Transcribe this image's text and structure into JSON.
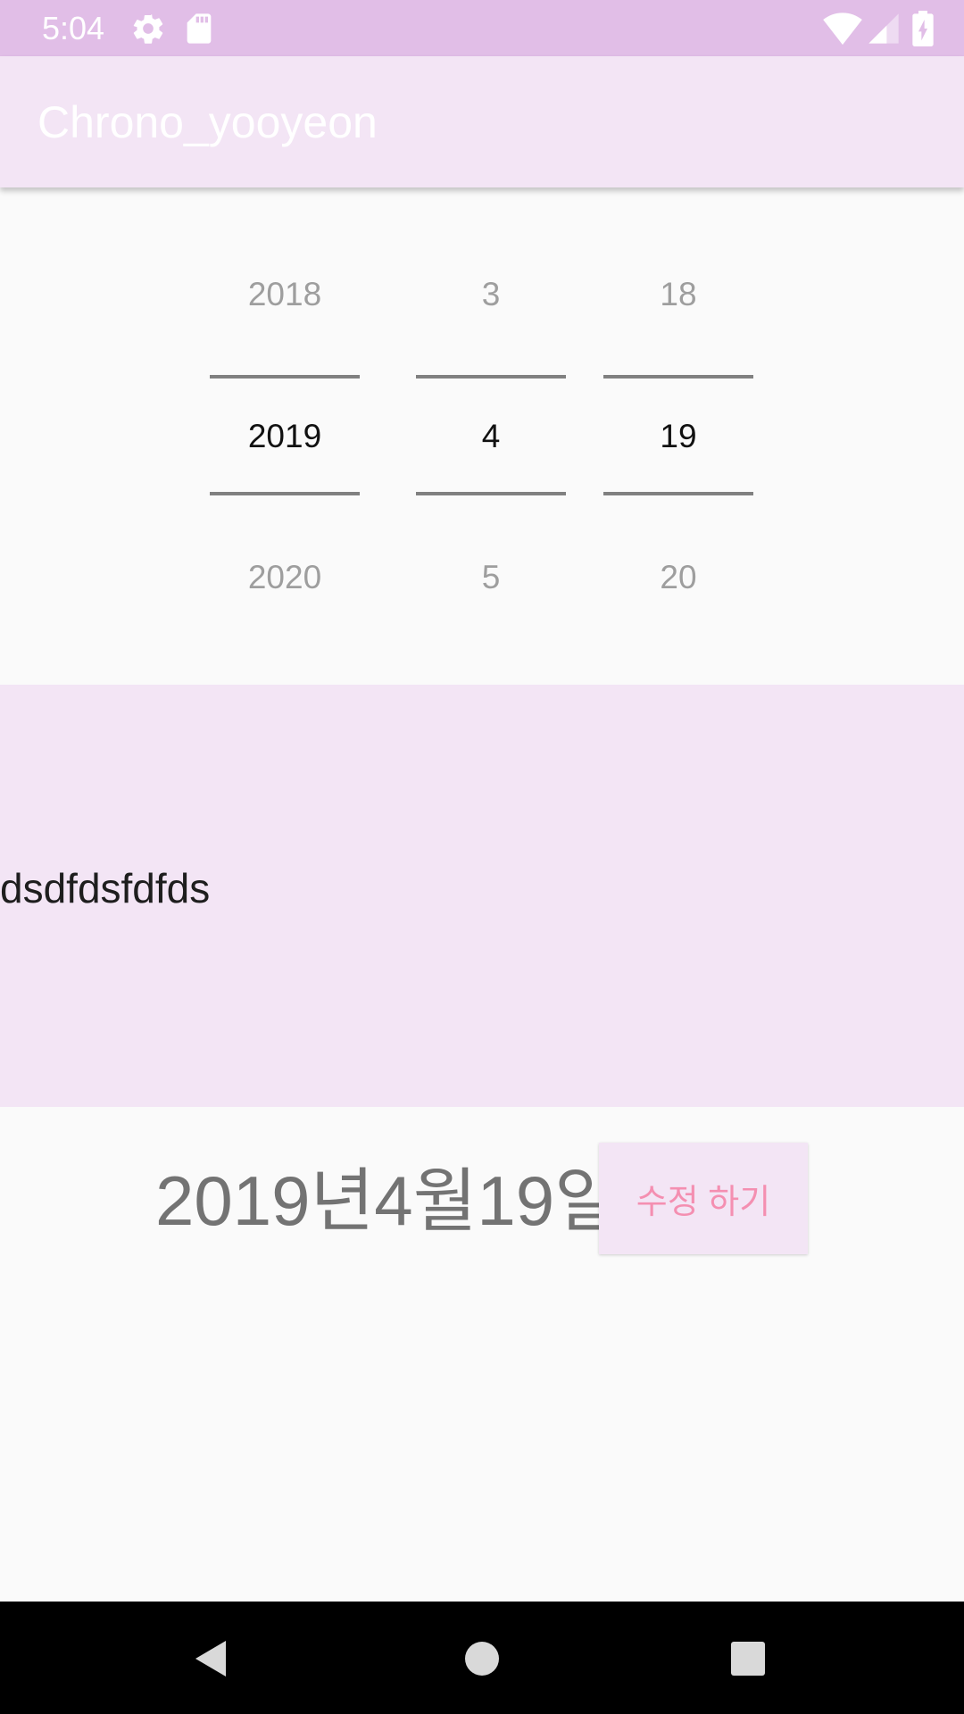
{
  "status_bar": {
    "time": "5:04",
    "icons": [
      "settings-icon",
      "sd-card-icon",
      "wifi-icon",
      "signal-icon",
      "battery-charging-icon"
    ],
    "color": "#E1BEE7"
  },
  "app_bar": {
    "title": "Chrono_yooyeon",
    "color": "#F3E5F5"
  },
  "date_picker": {
    "year": {
      "prev": "2018",
      "current": "2019",
      "next": "2020"
    },
    "month": {
      "prev": "3",
      "current": "4",
      "next": "5"
    },
    "day": {
      "prev": "18",
      "current": "19",
      "next": "20"
    }
  },
  "memo": {
    "text": "dsdfdsfdfds",
    "background": "#F3E5F5"
  },
  "selected_date_label": "2019년4월19일",
  "edit_button": {
    "label": "수정 하기",
    "text_color": "#F48FB1"
  },
  "nav_bar": {
    "buttons": [
      "back-icon",
      "home-icon",
      "recents-icon"
    ]
  }
}
